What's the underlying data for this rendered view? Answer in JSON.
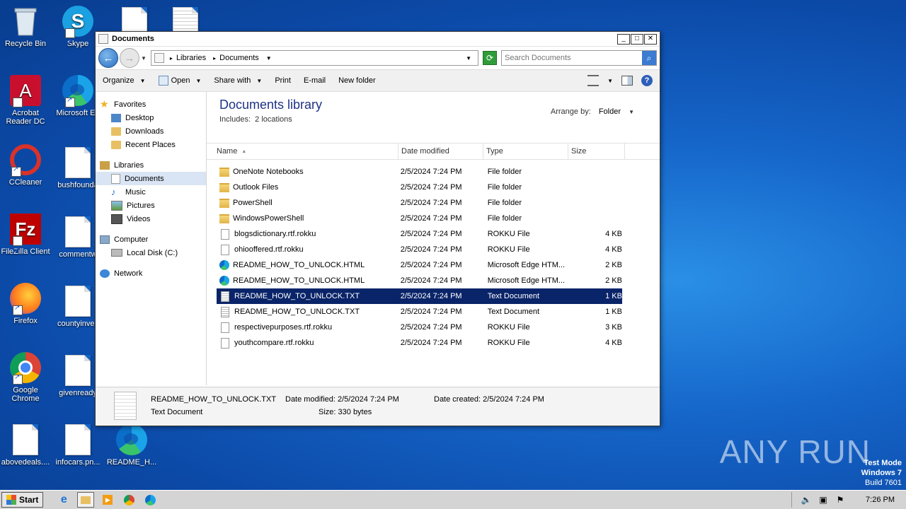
{
  "desktop": {
    "icons": [
      {
        "label": "Recycle Bin",
        "icon": "recycle-bin-icon"
      },
      {
        "label": "Skype",
        "icon": "skype-icon"
      },
      {
        "label": "Acrobat Reader DC",
        "icon": "acrobat-icon"
      },
      {
        "label": "Microsoft Ed",
        "icon": "edge-icon"
      },
      {
        "label": "CCleaner",
        "icon": "ccleaner-icon"
      },
      {
        "label": "bushfounda",
        "icon": "document-icon"
      },
      {
        "label": "FileZilla Client",
        "icon": "filezilla-icon"
      },
      {
        "label": "commentw",
        "icon": "document-icon"
      },
      {
        "label": "Firefox",
        "icon": "firefox-icon"
      },
      {
        "label": "countyinves",
        "icon": "document-icon"
      },
      {
        "label": "Google Chrome",
        "icon": "chrome-icon"
      },
      {
        "label": "givenready",
        "icon": "document-icon"
      },
      {
        "label": "abovedeals....",
        "icon": "document-icon"
      },
      {
        "label": "infocars.pn...",
        "icon": "document-icon"
      },
      {
        "label": "README_H...",
        "icon": "edge-icon"
      }
    ],
    "watermark": "ANY RUN",
    "testmode": {
      "line1": "Test Mode",
      "line2": "Windows 7",
      "line3": "Build 7601"
    }
  },
  "window": {
    "title": "Documents",
    "controls": {
      "minimize": "_",
      "maximize": "□",
      "close": "✕"
    },
    "address": {
      "crumbs": [
        "Libraries",
        "Documents"
      ]
    },
    "search": {
      "placeholder": "Search Documents"
    },
    "toolbar": {
      "organize": "Organize",
      "open": "Open",
      "share_with": "Share with",
      "print": "Print",
      "email": "E-mail",
      "new_folder": "New folder"
    },
    "nav": {
      "favorites": "Favorites",
      "desktop": "Desktop",
      "downloads": "Downloads",
      "recent_places": "Recent Places",
      "libraries": "Libraries",
      "documents": "Documents",
      "music": "Music",
      "pictures": "Pictures",
      "videos": "Videos",
      "computer": "Computer",
      "local_disk": "Local Disk (C:)",
      "network": "Network"
    },
    "library": {
      "title": "Documents library",
      "includes": "Includes:",
      "locations": "2 locations",
      "arrange_label": "Arrange by:",
      "arrange_value": "Folder"
    },
    "columns": {
      "name": "Name",
      "date": "Date modified",
      "type": "Type",
      "size": "Size"
    },
    "files": [
      {
        "name": "OneNote Notebooks",
        "date": "2/5/2024 7:24 PM",
        "type": "File folder",
        "size": "",
        "icon": "folder"
      },
      {
        "name": "Outlook Files",
        "date": "2/5/2024 7:24 PM",
        "type": "File folder",
        "size": "",
        "icon": "folder"
      },
      {
        "name": "PowerShell",
        "date": "2/5/2024 7:24 PM",
        "type": "File folder",
        "size": "",
        "icon": "folder"
      },
      {
        "name": "WindowsPowerShell",
        "date": "2/5/2024 7:24 PM",
        "type": "File folder",
        "size": "",
        "icon": "folder"
      },
      {
        "name": "blogsdictionary.rtf.rokku",
        "date": "2/5/2024 7:24 PM",
        "type": "ROKKU File",
        "size": "4 KB",
        "icon": "file"
      },
      {
        "name": "ohiooffered.rtf.rokku",
        "date": "2/5/2024 7:24 PM",
        "type": "ROKKU File",
        "size": "4 KB",
        "icon": "file"
      },
      {
        "name": "README_HOW_TO_UNLOCK.HTML",
        "date": "2/5/2024 7:24 PM",
        "type": "Microsoft Edge HTM...",
        "size": "2 KB",
        "icon": "edge"
      },
      {
        "name": "README_HOW_TO_UNLOCK.HTML",
        "date": "2/5/2024 7:24 PM",
        "type": "Microsoft Edge HTM...",
        "size": "2 KB",
        "icon": "edge"
      },
      {
        "name": "README_HOW_TO_UNLOCK.TXT",
        "date": "2/5/2024 7:24 PM",
        "type": "Text Document",
        "size": "1 KB",
        "icon": "txt",
        "selected": true
      },
      {
        "name": "README_HOW_TO_UNLOCK.TXT",
        "date": "2/5/2024 7:24 PM",
        "type": "Text Document",
        "size": "1 KB",
        "icon": "txt"
      },
      {
        "name": "respectivepurposes.rtf.rokku",
        "date": "2/5/2024 7:24 PM",
        "type": "ROKKU File",
        "size": "3 KB",
        "icon": "file"
      },
      {
        "name": "youthcompare.rtf.rokku",
        "date": "2/5/2024 7:24 PM",
        "type": "ROKKU File",
        "size": "4 KB",
        "icon": "file"
      }
    ],
    "details": {
      "filename": "README_HOW_TO_UNLOCK.TXT",
      "filetype": "Text Document",
      "modified_label": "Date modified:",
      "modified_value": "2/5/2024 7:24 PM",
      "size_label": "Size:",
      "size_value": "330 bytes",
      "created_label": "Date created:",
      "created_value": "2/5/2024 7:24 PM"
    }
  },
  "taskbar": {
    "start": "Start",
    "clock": "7:26 PM"
  }
}
